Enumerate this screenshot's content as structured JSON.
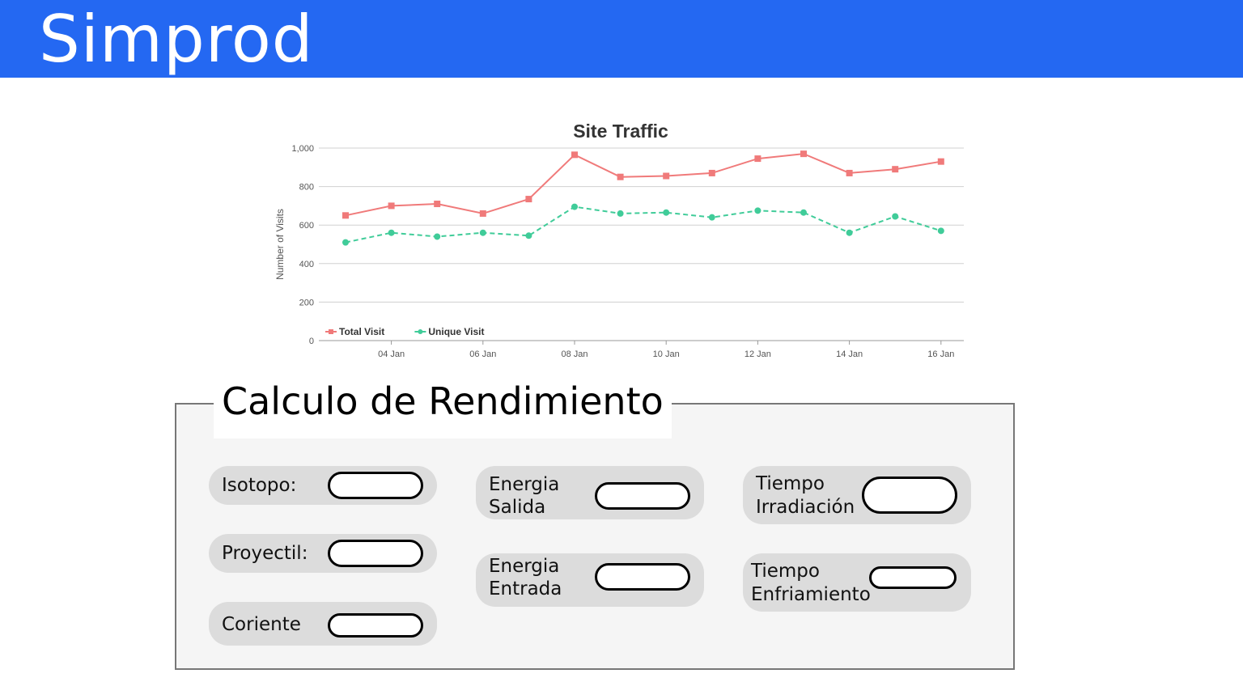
{
  "app": {
    "title": "Simprod"
  },
  "chart_data": {
    "type": "line",
    "title": "Site Traffic",
    "xlabel": "",
    "ylabel": "Number of Visits",
    "ylim": [
      0,
      1000
    ],
    "yticks": [
      "0",
      "200",
      "400",
      "600",
      "800",
      "1,000"
    ],
    "x": [
      "03 Jan",
      "04 Jan",
      "05 Jan",
      "06 Jan",
      "07 Jan",
      "08 Jan",
      "09 Jan",
      "10 Jan",
      "11 Jan",
      "12 Jan",
      "13 Jan",
      "14 Jan",
      "15 Jan",
      "16 Jan"
    ],
    "xtick_labels": [
      "04 Jan",
      "06 Jan",
      "08 Jan",
      "10 Jan",
      "12 Jan",
      "14 Jan",
      "16 Jan"
    ],
    "grid": true,
    "legend_position": "bottom-left",
    "series": [
      {
        "name": "Total Visit",
        "color": "#f07a7a",
        "marker": "square",
        "dash": false,
        "values": [
          650,
          700,
          710,
          660,
          735,
          965,
          850,
          855,
          870,
          945,
          970,
          870,
          890,
          930
        ]
      },
      {
        "name": "Unique Visit",
        "color": "#40cc99",
        "marker": "circle",
        "dash": true,
        "values": [
          510,
          560,
          540,
          560,
          545,
          695,
          660,
          665,
          640,
          675,
          665,
          560,
          645,
          570
        ]
      }
    ]
  },
  "form": {
    "title": "Calculo de Rendimiento",
    "fields": {
      "isotopo": {
        "label": "Isotopo:",
        "value": ""
      },
      "proyectil": {
        "label": "Proyectil:",
        "value": ""
      },
      "coriente": {
        "label": "Coriente",
        "value": ""
      },
      "energia_salida": {
        "label_line1": "Energia",
        "label_line2": "Salida",
        "value": ""
      },
      "energia_entrada": {
        "label_line1": "Energia",
        "label_line2": "Entrada",
        "value": ""
      },
      "tiempo_irradiacion": {
        "label_line1": "Tiempo",
        "label_line2": "Irradiación",
        "value": ""
      },
      "tiempo_enfriamiento": {
        "label_line1": "Tiempo",
        "label_line2": "Enfriamiento",
        "value": ""
      }
    }
  }
}
